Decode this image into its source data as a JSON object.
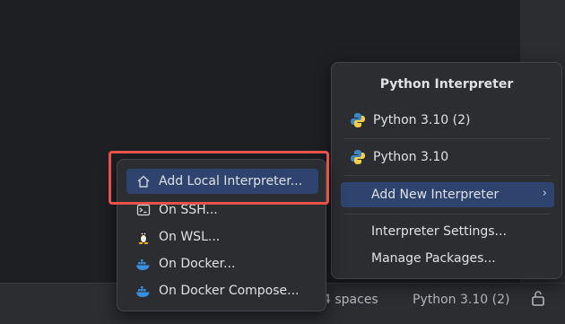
{
  "status_bar": {
    "indent": "4 spaces",
    "interpreter": "Python 3.10 (2)"
  },
  "interpreter_popup": {
    "title": "Python Interpreter",
    "items": [
      {
        "label": "Python 3.10 (2)",
        "icon": "python-icon"
      },
      {
        "label": "Python 3.10",
        "icon": "python-icon"
      },
      {
        "label": "Add New Interpreter",
        "selected": true,
        "submenu": true
      },
      {
        "label": "Interpreter Settings..."
      },
      {
        "label": "Manage Packages..."
      }
    ]
  },
  "add_interpreter_popup": {
    "items": [
      {
        "label": "Add Local Interpreter...",
        "icon": "home-icon",
        "selected": true
      },
      {
        "label": "On SSH...",
        "icon": "terminal-icon"
      },
      {
        "label": "On WSL...",
        "icon": "linux-penguin-icon"
      },
      {
        "label": "On Docker...",
        "icon": "docker-icon"
      },
      {
        "label": "On Docker Compose...",
        "icon": "docker-icon"
      }
    ]
  },
  "colors": {
    "selection": "#2e436e",
    "highlight_box": "#e5534b",
    "popup_bg": "#2b2d30"
  }
}
